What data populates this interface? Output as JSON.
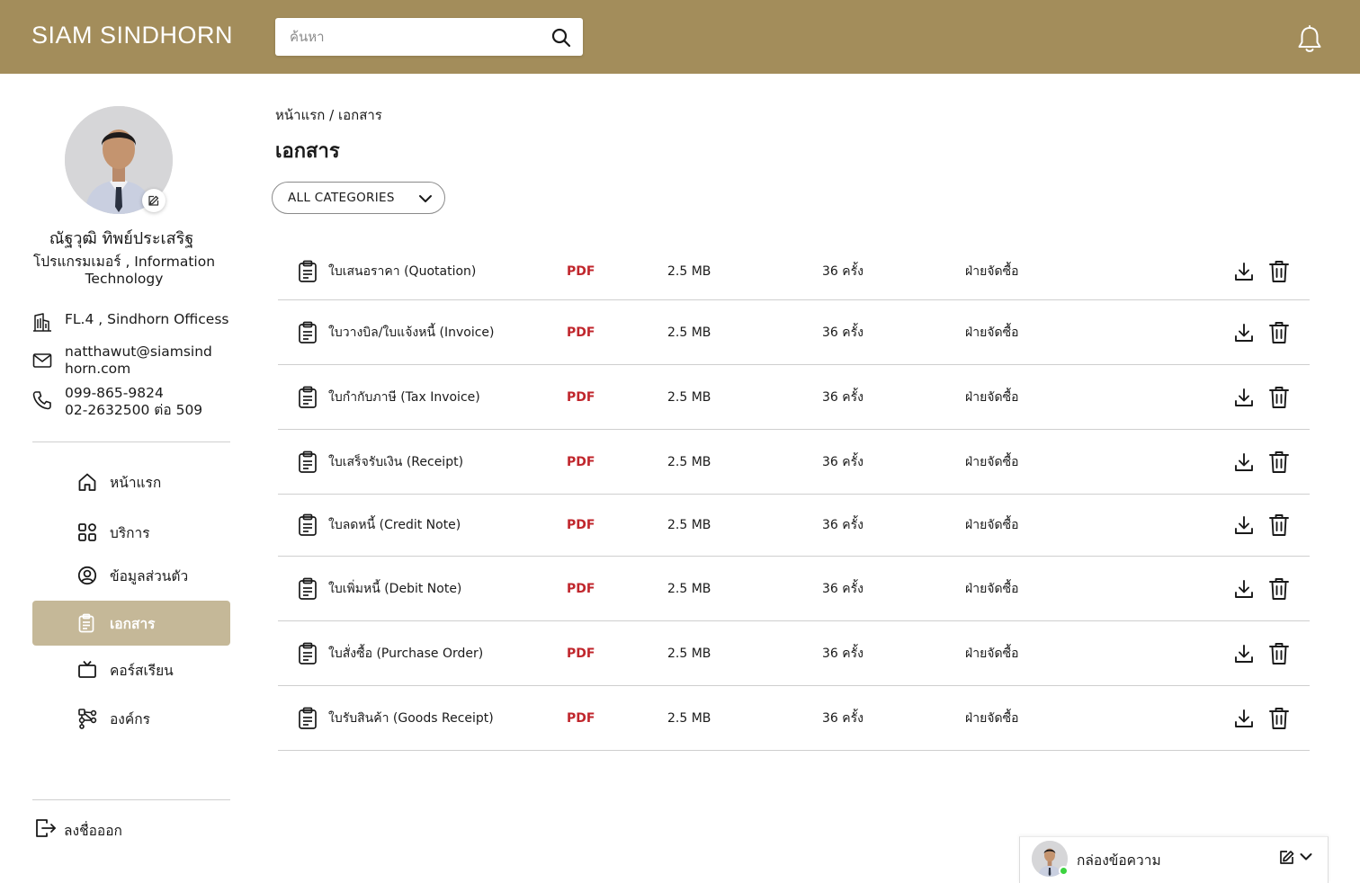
{
  "header": {
    "brand": "SIAM SINDHORN",
    "search_placeholder": "ค้นหา",
    "search_value": "",
    "bg_color": "#a38d5b"
  },
  "profile": {
    "name": "ณัฐวุฒิ ทิพย์ประเสริฐ",
    "role": "โปรแกรมเมอร์ , Information Technology",
    "location": "FL.4 , Sindhorn Officess",
    "email": "natthawut@siamsindhorn.com",
    "phone_mobile": "099-865-9824",
    "phone_office": "02-2632500 ต่อ 509"
  },
  "nav": {
    "items": [
      {
        "label": "หน้าแรก",
        "icon": "home-icon",
        "active": false
      },
      {
        "label": "บริการ",
        "icon": "grid-icon",
        "active": false
      },
      {
        "label": "ข้อมูลส่วนตัว",
        "icon": "user-circle-icon",
        "active": false
      },
      {
        "label": "เอกสาร",
        "icon": "clipboard-icon",
        "active": true
      },
      {
        "label": "คอร์สเรียน",
        "icon": "tv-icon",
        "active": false
      },
      {
        "label": "องค์กร",
        "icon": "org-chart-icon",
        "active": false
      }
    ],
    "logout_label": "ลงชื่อออก",
    "active_bg": "#c5b898"
  },
  "main": {
    "breadcrumb": {
      "home": "หน้าแรก",
      "separator": "/",
      "current": "เอกสาร"
    },
    "title": "เอกสาร",
    "category_filter": "ALL CATEGORIES",
    "documents": [
      {
        "name": "ใบเสนอราคา (Quotation)",
        "type": "PDF",
        "size": "2.5 MB",
        "downloads": "36 ครั้ง",
        "department": "ฝ่ายจัดซื้อ"
      },
      {
        "name": "ใบวางบิล/ใบแจ้งหนี้ (Invoice)",
        "type": "PDF",
        "size": "2.5 MB",
        "downloads": "36 ครั้ง",
        "department": "ฝ่ายจัดซื้อ"
      },
      {
        "name": "ใบกำกับภาษี (Tax Invoice)",
        "type": "PDF",
        "size": "2.5 MB",
        "downloads": "36 ครั้ง",
        "department": "ฝ่ายจัดซื้อ"
      },
      {
        "name": "ใบเสร็จรับเงิน (Receipt)",
        "type": "PDF",
        "size": "2.5 MB",
        "downloads": "36 ครั้ง",
        "department": "ฝ่ายจัดซื้อ"
      },
      {
        "name": "ใบลดหนี้ (Credit Note)",
        "type": "PDF",
        "size": "2.5 MB",
        "downloads": "36 ครั้ง",
        "department": "ฝ่ายจัดซื้อ"
      },
      {
        "name": "ใบเพิ่มหนี้ (Debit Note)",
        "type": "PDF",
        "size": "2.5 MB",
        "downloads": "36 ครั้ง",
        "department": "ฝ่ายจัดซื้อ"
      },
      {
        "name": "ใบสั่งซื้อ (Purchase Order)",
        "type": "PDF",
        "size": "2.5 MB",
        "downloads": "36 ครั้ง",
        "department": "ฝ่ายจัดซื้อ"
      },
      {
        "name": "ใบรับสินค้า (Goods Receipt)",
        "type": "PDF",
        "size": "2.5 MB",
        "downloads": "36 ครั้ง",
        "department": "ฝ่ายจัดซื้อ"
      }
    ],
    "pdf_color": "#c0262c"
  },
  "messages": {
    "title": "กล่องข้อความ",
    "online_color": "#3bd33f"
  }
}
